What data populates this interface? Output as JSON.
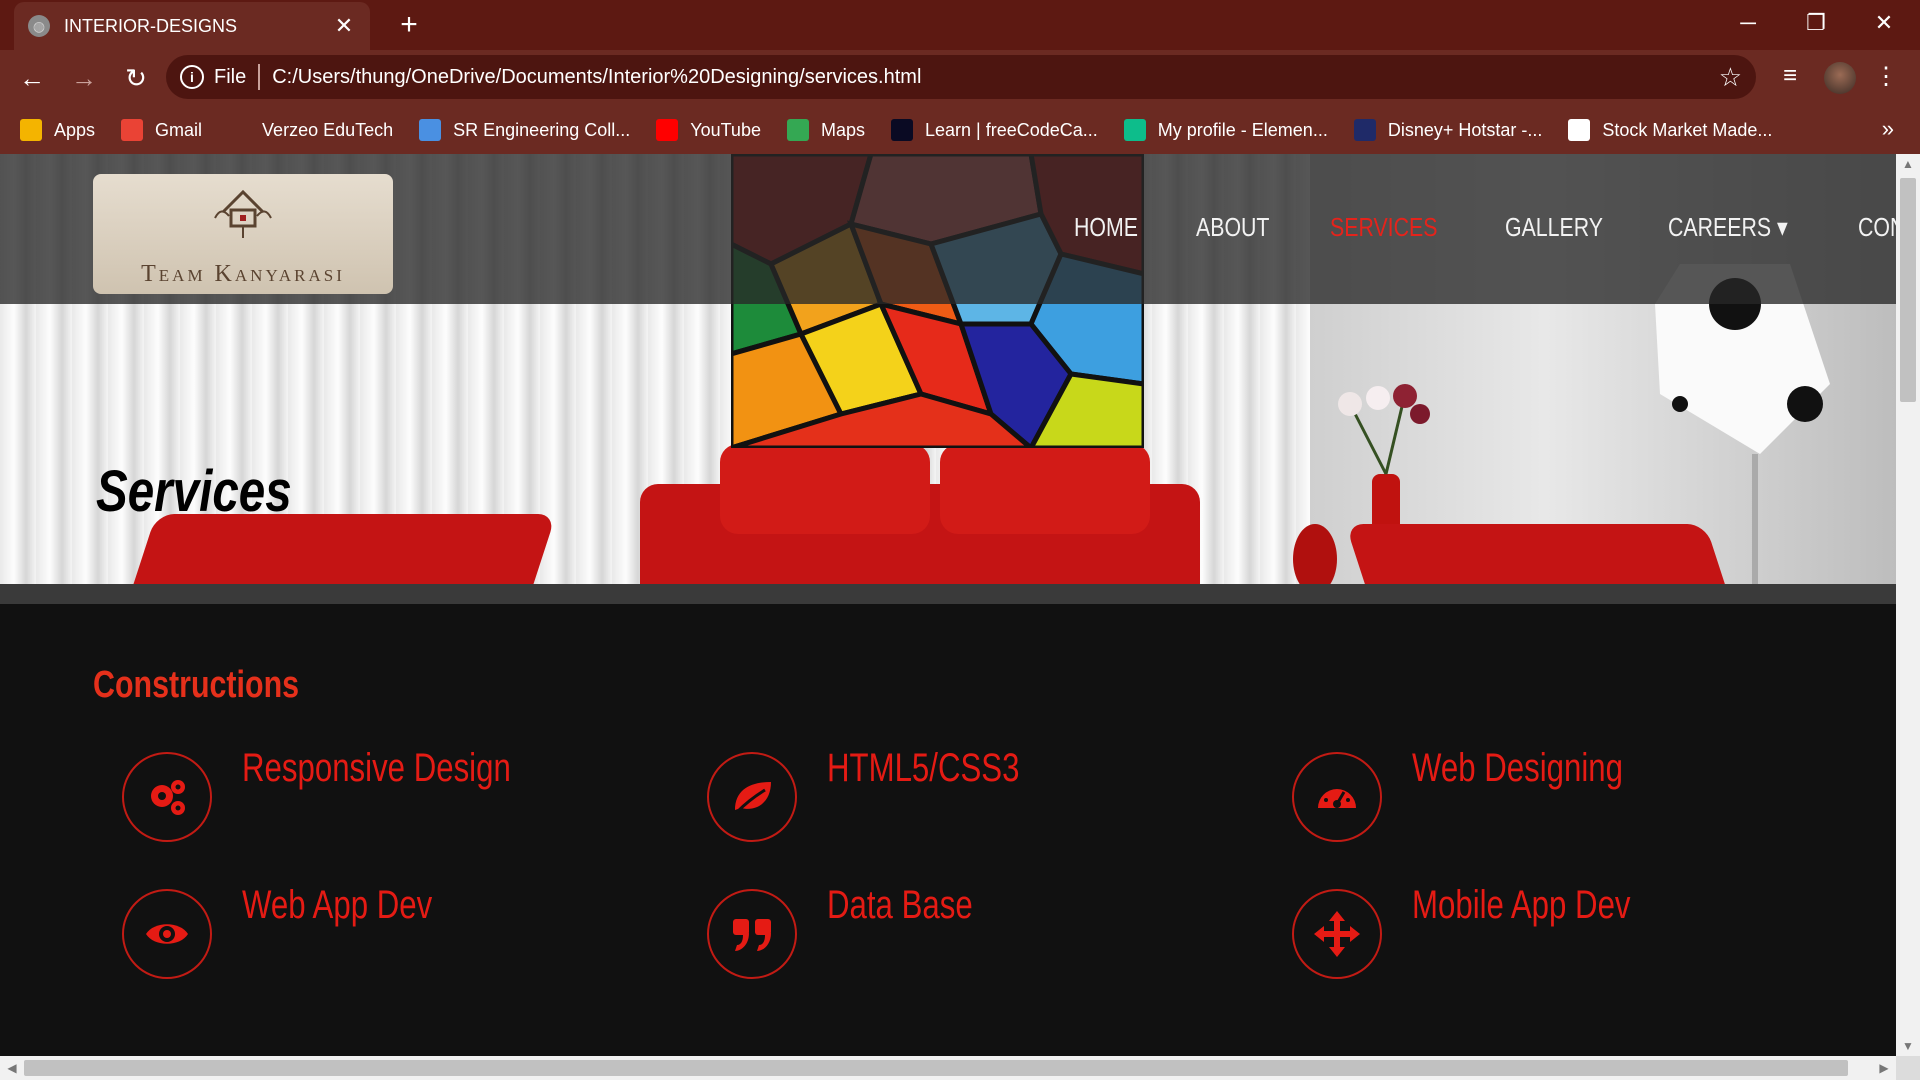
{
  "browser": {
    "tab_title": "INTERIOR-DESIGNS",
    "tab_close": "✕",
    "new_tab": "+",
    "window_controls": {
      "minimize": "─",
      "restore": "❐",
      "close": "✕"
    },
    "nav": {
      "back": "←",
      "forward": "→",
      "reload": "↻"
    },
    "address": {
      "info_icon": "i",
      "scheme": "File",
      "url": "C:/Users/thung/OneDrive/Documents/Interior%20Designing/services.html"
    },
    "star": "☆",
    "media_icon": "≡",
    "menu_icon": "⋮",
    "bookmarks": [
      {
        "label": "Apps",
        "icon": "apps-grid-icon",
        "color": "#f4b400"
      },
      {
        "label": "Gmail",
        "icon": "gmail-icon",
        "color": "#ea4335"
      },
      {
        "label": "Verzeo EduTech",
        "icon": "verzeo-icon",
        "color": "#6b2a22"
      },
      {
        "label": "SR Engineering Coll...",
        "icon": "sr-engineering-icon",
        "color": "#4a90e2"
      },
      {
        "label": "YouTube",
        "icon": "youtube-icon",
        "color": "#ff0000"
      },
      {
        "label": "Maps",
        "icon": "maps-icon",
        "color": "#34a853"
      },
      {
        "label": "Learn | freeCodeCa...",
        "icon": "freecodecamp-icon",
        "color": "#0a0a23"
      },
      {
        "label": "My profile - Elemen...",
        "icon": "element-icon",
        "color": "#0dbd8b"
      },
      {
        "label": "Disney+ Hotstar -...",
        "icon": "hotstar-icon",
        "color": "#1f2a68"
      },
      {
        "label": "Stock Market Made...",
        "icon": "stock-market-icon",
        "color": "#ffffff"
      }
    ],
    "bookmarks_more": "»"
  },
  "site": {
    "logo_text": "Team Kanyarasi",
    "nav": [
      {
        "label": "HOME",
        "active": false
      },
      {
        "label": "ABOUT",
        "active": false
      },
      {
        "label": "SERVICES",
        "active": true
      },
      {
        "label": "GALLERY",
        "active": false
      },
      {
        "label": "CAREERS ▾",
        "active": false
      },
      {
        "label": "CONTACT",
        "active": false
      }
    ],
    "hero_title": "Services",
    "section_title": "Constructions",
    "services": [
      {
        "label": "Responsive Design",
        "icon": "cogs-icon"
      },
      {
        "label": "HTML5/CSS3",
        "icon": "leaf-icon"
      },
      {
        "label": "Web Designing",
        "icon": "dashboard-icon"
      },
      {
        "label": "Web App Dev",
        "icon": "eye-icon"
      },
      {
        "label": "Data Base",
        "icon": "quote-icon"
      },
      {
        "label": "Mobile App Dev",
        "icon": "arrows-move-icon"
      }
    ],
    "accent_color": "#e5231b"
  }
}
